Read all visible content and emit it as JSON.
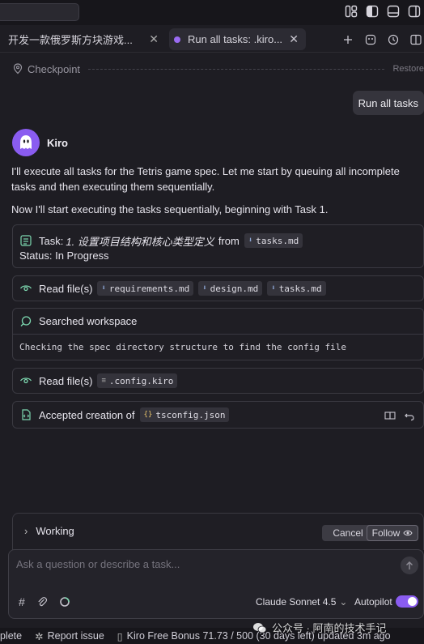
{
  "tabs": [
    {
      "label": "开发一款俄罗斯方块游戏..."
    },
    {
      "label": "Run all tasks: .kiro..."
    }
  ],
  "checkpoint": {
    "label": "Checkpoint",
    "restore": "Restore"
  },
  "user_message": "Run all tasks",
  "assistant": {
    "name": "Kiro",
    "para1": "I'll execute all tasks for the Tetris game spec. Let me start by queuing all incomplete tasks and then executing them sequentially.",
    "para2": "Now I'll start executing the tasks sequentially, beginning with Task 1."
  },
  "task_card": {
    "prefix": "Task: ",
    "task_name": "1. 设置项目结构和核心类型定义",
    "from": "from",
    "file": "tasks.md",
    "status": "Status: In Progress"
  },
  "read1": {
    "label": "Read file(s)",
    "files": [
      "requirements.md",
      "design.md",
      "tasks.md"
    ]
  },
  "search": {
    "label": "Searched workspace",
    "detail": "Checking the spec directory structure to find the config file"
  },
  "read2": {
    "label": "Read file(s)",
    "file": ".config.kiro"
  },
  "accepted": {
    "label": "Accepted creation of",
    "file": "tsconfig.json"
  },
  "working": {
    "label": "Working",
    "cancel": "Cancel",
    "follow": "Follow"
  },
  "input": {
    "placeholder": "Ask a question or describe a task...",
    "model": "Claude Sonnet 4.5",
    "autopilot": "Autopilot"
  },
  "status_bar": {
    "left": "plete",
    "report": "Report issue",
    "bonus": "Kiro Free Bonus 71.73 / 500 (30 days left) updated 3m ago"
  },
  "watermark": "公众号 · 阿南的技术手记",
  "colors": {
    "accent": "#8a5cf0",
    "background": "#1e1d23",
    "card_border": "#3a3941"
  },
  "icons": [
    "layout-icon",
    "sidebar-icon",
    "panel-icon",
    "split-icon",
    "plus-icon",
    "history-icon",
    "kiro-ghost-icon",
    "location-pin-icon",
    "tasklist-icon",
    "eye-icon",
    "search-icon",
    "file-icon",
    "diff-icon",
    "undo-icon",
    "hash-icon",
    "paperclip-icon",
    "spinner-icon",
    "send-arrow-icon",
    "chevron-right-icon"
  ]
}
